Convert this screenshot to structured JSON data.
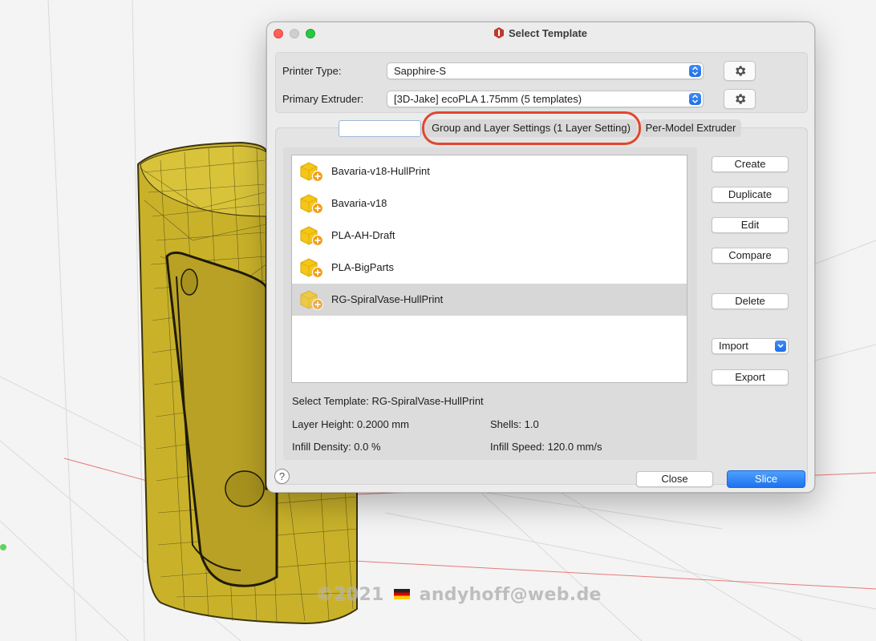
{
  "colors": {
    "accent": "#1d72f0",
    "highlight_ring": "#e0472f",
    "model_yellow": "#c9b22a",
    "grid_red": "#e87a7a"
  },
  "window": {
    "title": "Select Template",
    "title_icon": "app-logo-icon"
  },
  "printer": {
    "type_label": "Printer Type:",
    "type_value": "Sapphire-S",
    "extruder_label": "Primary Extruder:",
    "extruder_value": "[3D-Jake] ecoPLA 1.75mm (5 templates)",
    "settings_icon": "gear-icon"
  },
  "tabs": {
    "search_value": "",
    "group": "Group and Layer Settings (1 Layer Setting)",
    "extruder": "Per-Model Extruder"
  },
  "templates": [
    {
      "label": "Bavaria-v18-HullPrint",
      "icon": "template-box-add-icon",
      "selected": false
    },
    {
      "label": "Bavaria-v18",
      "icon": "template-box-add-icon",
      "selected": false
    },
    {
      "label": "PLA-AH-Draft",
      "icon": "template-box-add-icon",
      "selected": false
    },
    {
      "label": "PLA-BigParts",
      "icon": "template-box-add-icon",
      "selected": false
    },
    {
      "label": "RG-SpiralVase-HullPrint",
      "icon": "template-box-add-icon",
      "selected": true
    }
  ],
  "info": {
    "selected_template": "Select Template: RG-SpiralVase-HullPrint",
    "layer_height": "Layer Height: 0.2000 mm",
    "shells": "Shells: 1.0",
    "infill_density": "Infill Density: 0.0 %",
    "infill_speed": "Infill Speed: 120.0 mm/s"
  },
  "buttons": {
    "create": "Create",
    "duplicate": "Duplicate",
    "edit": "Edit",
    "compare": "Compare",
    "delete": "Delete",
    "import": "Import",
    "export": "Export",
    "help": "?",
    "close": "Close",
    "slice": "Slice"
  },
  "watermark": {
    "copyright": "©2021",
    "email": "andyhoff@web.de"
  }
}
